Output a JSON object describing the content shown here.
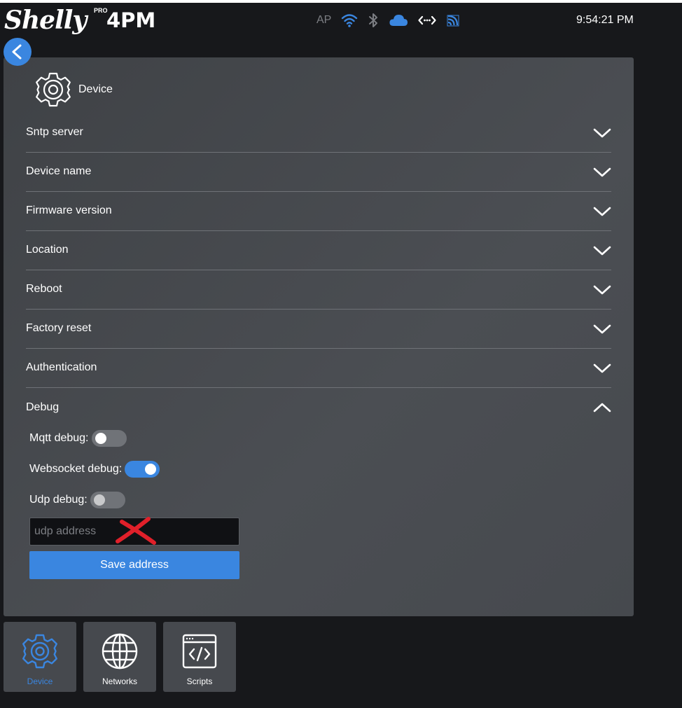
{
  "app": {
    "brand": "Shelly",
    "brand_tier": "PRO",
    "model": "4PM"
  },
  "status_bar": {
    "ap_label": "AP",
    "icons": [
      "wifi-icon",
      "bluetooth-icon",
      "cloud-icon",
      "websocket-icon",
      "mqtt-icon"
    ],
    "active_color": "#3a86e0",
    "inactive_color": "#7c7e83",
    "clock": "9:54:21 PM"
  },
  "panel": {
    "title": "Device",
    "sections": [
      {
        "label": "Sntp server",
        "expanded": false
      },
      {
        "label": "Device name",
        "expanded": false
      },
      {
        "label": "Firmware version",
        "expanded": false
      },
      {
        "label": "Location",
        "expanded": false
      },
      {
        "label": "Reboot",
        "expanded": false
      },
      {
        "label": "Factory reset",
        "expanded": false
      },
      {
        "label": "Authentication",
        "expanded": false
      },
      {
        "label": "Debug",
        "expanded": true
      }
    ],
    "debug": {
      "mqtt_label": "Mqtt debug:",
      "mqtt_on": false,
      "websocket_label": "Websocket debug:",
      "websocket_on": true,
      "udp_label": "Udp debug:",
      "udp_on": false,
      "udp_placeholder": "udp address",
      "udp_value": "",
      "save_label": "Save address"
    }
  },
  "bottom_nav": [
    {
      "label": "Device",
      "icon": "gear-icon",
      "active": true
    },
    {
      "label": "Networks",
      "icon": "globe-icon",
      "active": false
    },
    {
      "label": "Scripts",
      "icon": "code-window-icon",
      "active": false
    }
  ],
  "colors": {
    "accent": "#3a86e0",
    "background": "#17181b",
    "panel": "#46494e",
    "annotation_red": "#e0202a"
  }
}
